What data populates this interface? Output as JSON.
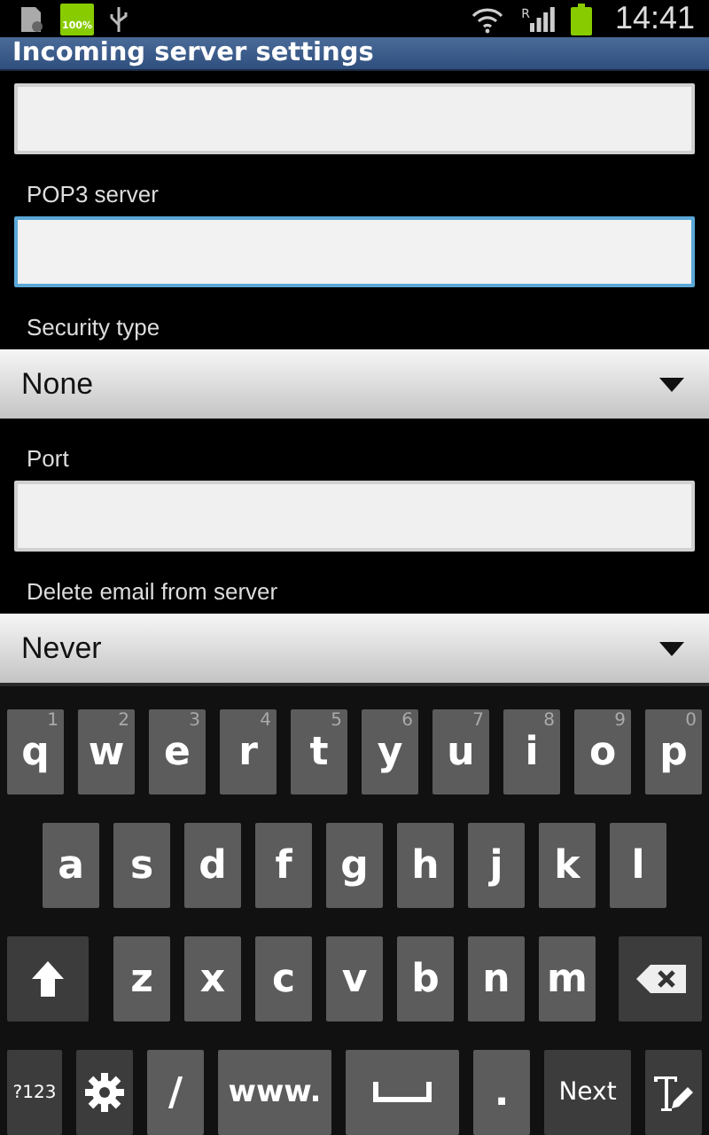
{
  "status_bar": {
    "battery_badge": "100%",
    "roaming": "R",
    "time": "14:41"
  },
  "title": "Incoming server settings",
  "fields": [
    {
      "kind": "text",
      "focused": false
    },
    {
      "kind": "text",
      "label": "POP3 server",
      "focused": true
    },
    {
      "kind": "dropdown",
      "label": "Security type",
      "value": "None"
    },
    {
      "kind": "text",
      "label": "Port",
      "focused": false
    },
    {
      "kind": "dropdown",
      "label": "Delete email from server",
      "value": "Never"
    }
  ],
  "keyboard": {
    "rows": [
      {
        "keys": [
          {
            "kind": "letter",
            "label": "q",
            "hint": "1"
          },
          {
            "kind": "letter",
            "label": "w",
            "hint": "2"
          },
          {
            "kind": "letter",
            "label": "e",
            "hint": "3"
          },
          {
            "kind": "letter",
            "label": "r",
            "hint": "4"
          },
          {
            "kind": "letter",
            "label": "t",
            "hint": "5"
          },
          {
            "kind": "letter",
            "label": "y",
            "hint": "6"
          },
          {
            "kind": "letter",
            "label": "u",
            "hint": "7"
          },
          {
            "kind": "letter",
            "label": "i",
            "hint": "8"
          },
          {
            "kind": "letter",
            "label": "o",
            "hint": "9"
          },
          {
            "kind": "letter",
            "label": "p",
            "hint": "0"
          }
        ]
      },
      {
        "keys": [
          {
            "kind": "letter",
            "label": "a"
          },
          {
            "kind": "letter",
            "label": "s"
          },
          {
            "kind": "letter",
            "label": "d"
          },
          {
            "kind": "letter",
            "label": "f"
          },
          {
            "kind": "letter",
            "label": "g"
          },
          {
            "kind": "letter",
            "label": "h"
          },
          {
            "kind": "letter",
            "label": "j"
          },
          {
            "kind": "letter",
            "label": "k"
          },
          {
            "kind": "letter",
            "label": "l"
          }
        ]
      },
      {
        "keys": [
          {
            "kind": "shift"
          },
          {
            "kind": "letter",
            "label": "z"
          },
          {
            "kind": "letter",
            "label": "x"
          },
          {
            "kind": "letter",
            "label": "c"
          },
          {
            "kind": "letter",
            "label": "v"
          },
          {
            "kind": "letter",
            "label": "b"
          },
          {
            "kind": "letter",
            "label": "n"
          },
          {
            "kind": "letter",
            "label": "m"
          },
          {
            "kind": "backspace"
          }
        ]
      },
      {
        "keys": [
          {
            "kind": "symbols",
            "label": "?123"
          },
          {
            "kind": "settings"
          },
          {
            "kind": "char",
            "label": "/"
          },
          {
            "kind": "wide",
            "label": "www."
          },
          {
            "kind": "space"
          },
          {
            "kind": "char",
            "label": "."
          },
          {
            "kind": "action",
            "label": "Next"
          },
          {
            "kind": "input-mode"
          }
        ]
      }
    ]
  }
}
